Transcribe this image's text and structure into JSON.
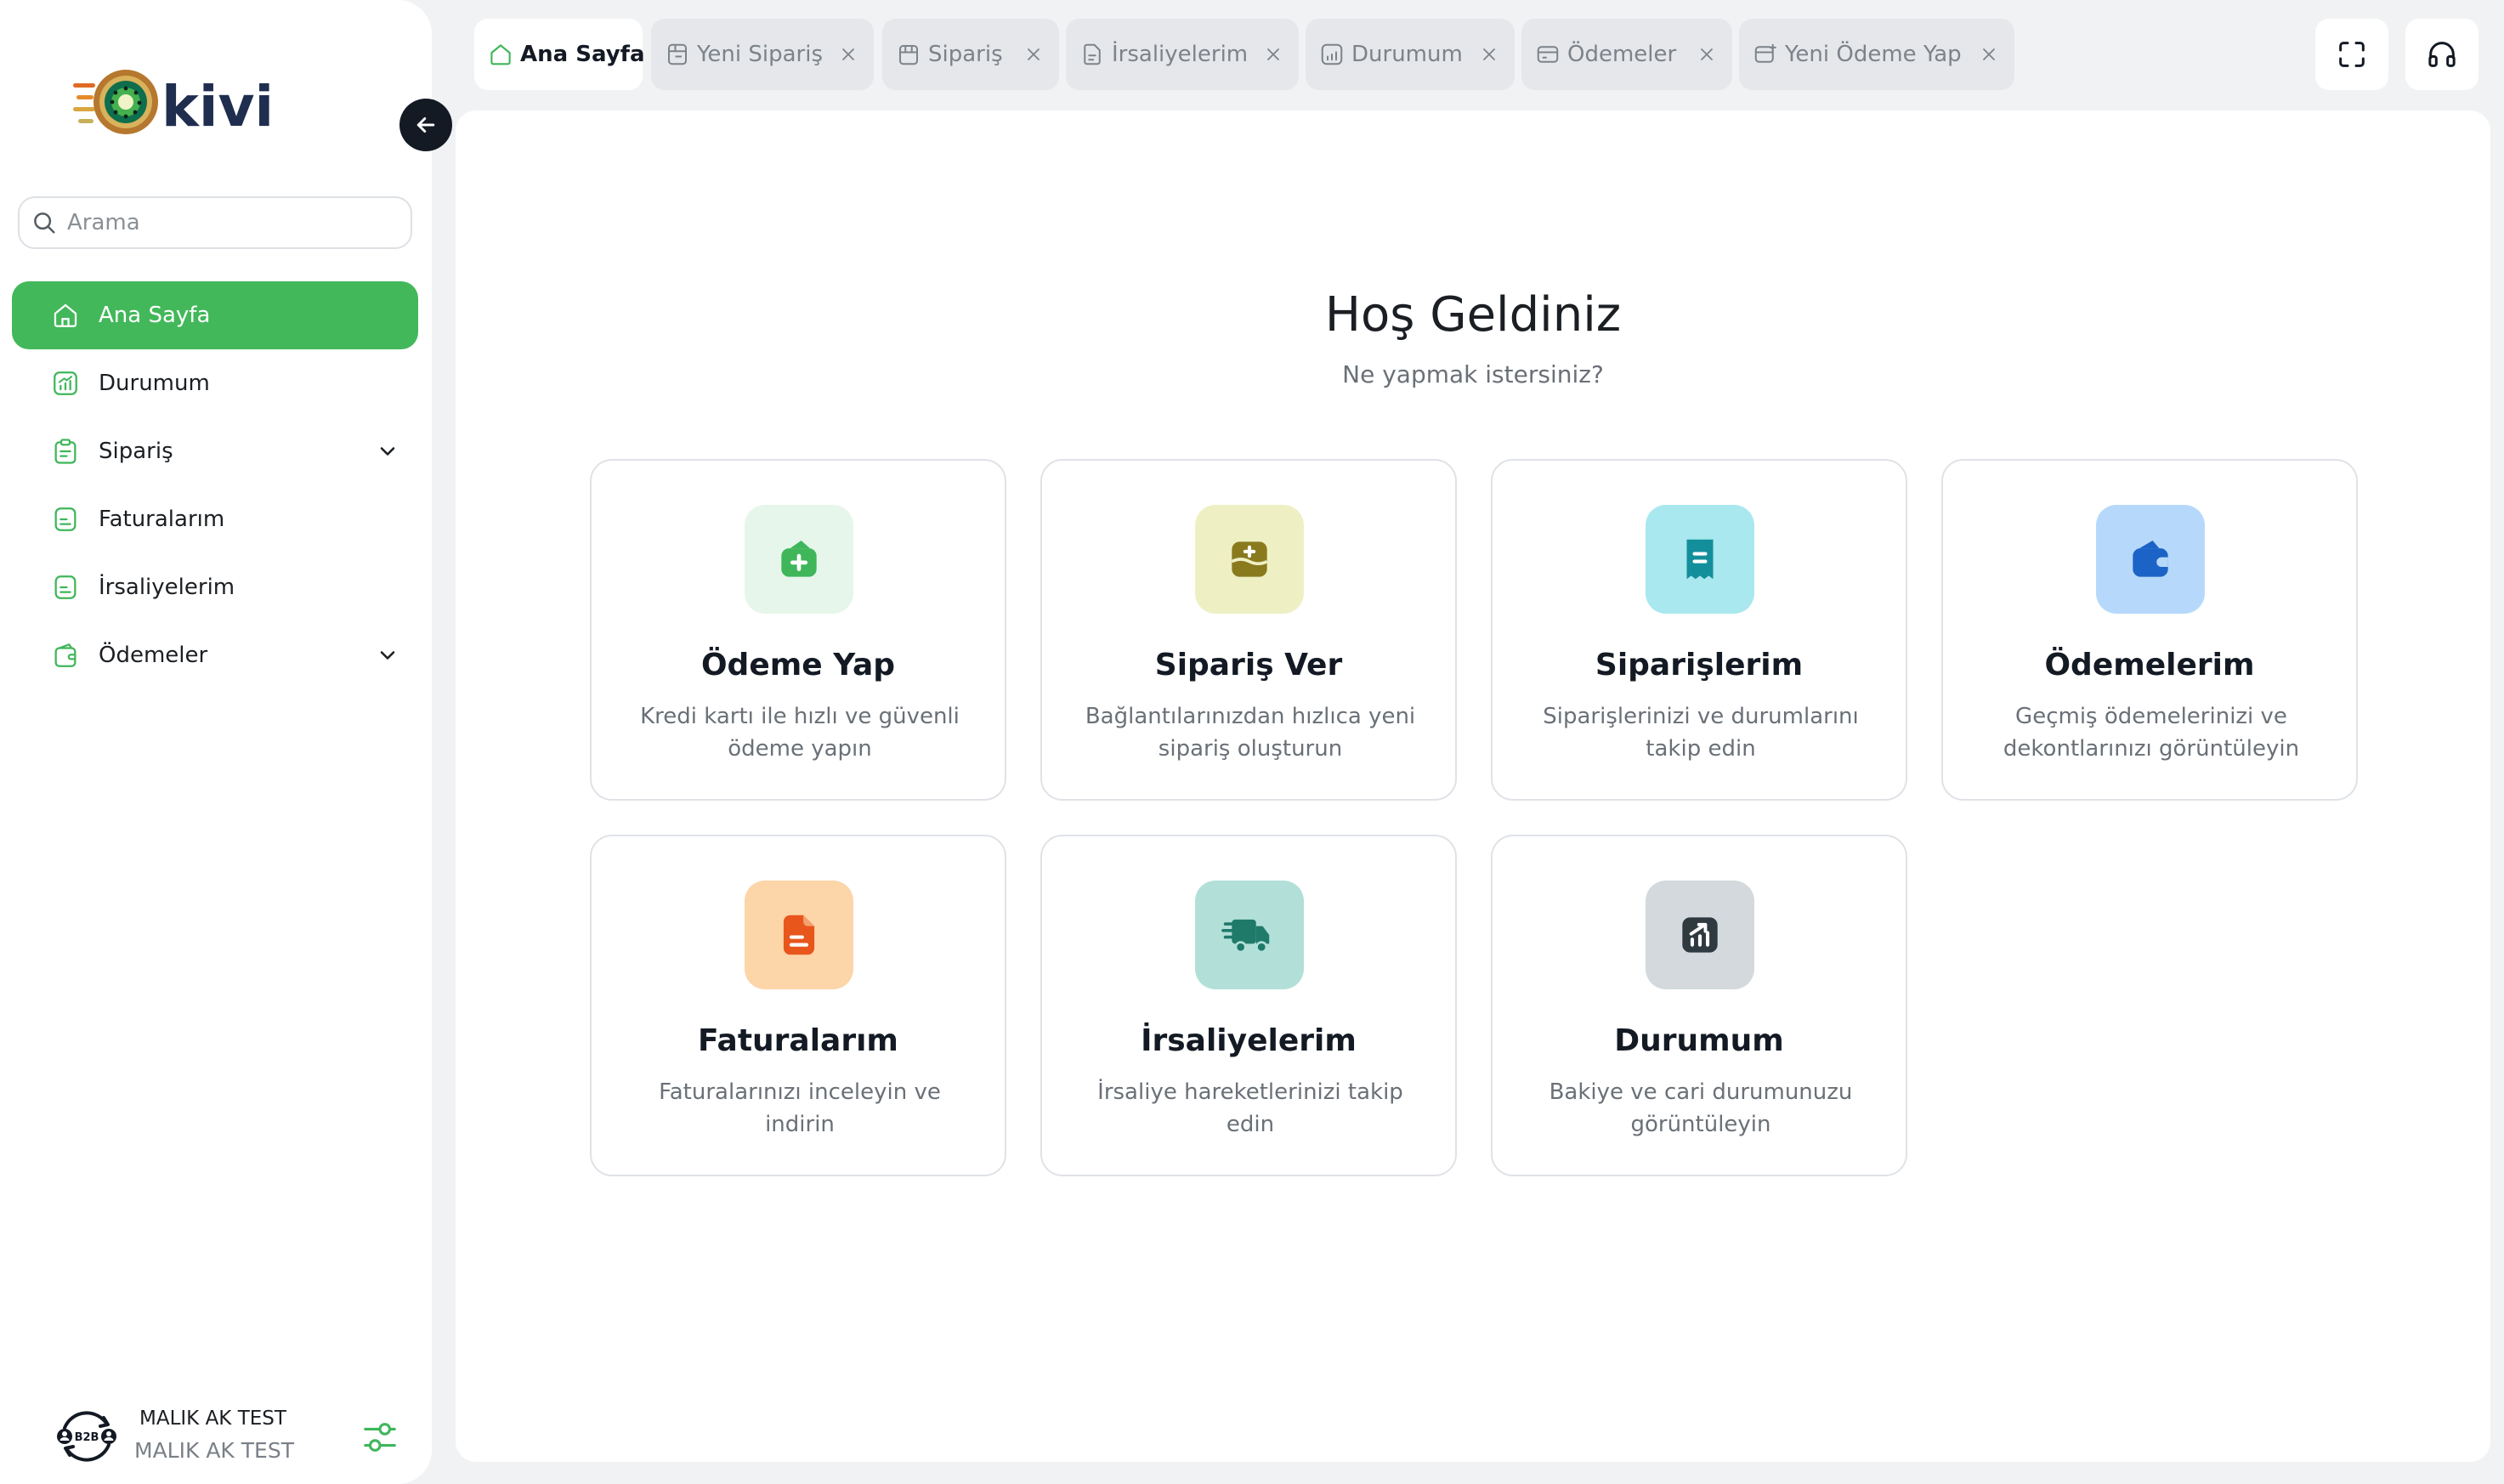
{
  "logo": {
    "text": "kivi"
  },
  "search": {
    "placeholder": "Arama",
    "value": ""
  },
  "sidebar": {
    "items": [
      {
        "label": "Ana Sayfa",
        "icon": "home-icon",
        "active": true
      },
      {
        "label": "Durumum",
        "icon": "chart-icon"
      },
      {
        "label": "Sipariş",
        "icon": "clipboard-icon",
        "expandable": true
      },
      {
        "label": "Faturalarım",
        "icon": "document-icon"
      },
      {
        "label": "İrsaliyelerim",
        "icon": "document-icon"
      },
      {
        "label": "Ödemeler",
        "icon": "wallet-icon",
        "expandable": true
      }
    ]
  },
  "user": {
    "name": "MALIK AK TEST",
    "company": "MALIK AK TEST",
    "avatar_text": "B2B"
  },
  "tabs": [
    {
      "label": "Ana Sayfa",
      "icon": "home-icon",
      "active": true,
      "closable": false
    },
    {
      "label": "Yeni Sipariş",
      "icon": "cart-icon",
      "closable": true
    },
    {
      "label": "Sipariş",
      "icon": "shop-icon",
      "closable": true
    },
    {
      "label": "İrsaliyelerim",
      "icon": "document-icon",
      "closable": true
    },
    {
      "label": "Durumum",
      "icon": "chart-icon",
      "closable": true
    },
    {
      "label": "Ödemeler",
      "icon": "card-icon",
      "closable": true
    },
    {
      "label": "Yeni Ödeme Yap",
      "icon": "payment-add-icon",
      "closable": true
    }
  ],
  "toolbar": {
    "fullscreen_icon": "fullscreen-icon",
    "support_icon": "headphones-icon"
  },
  "main": {
    "title": "Hoş Geldiniz",
    "subtitle": "Ne yapmak istersiniz?",
    "cards": [
      {
        "title": "Ödeme Yap",
        "desc": "Kredi kartı ile hızlı ve güvenli ödeme yapın",
        "icon": "wallet-add-icon",
        "bg": "#e6f6ea",
        "fg": "#3fb65a"
      },
      {
        "title": "Sipariş Ver",
        "desc": "Bağlantılarınızdan hızlıca yeni sipariş oluşturun",
        "icon": "box-add-icon",
        "bg": "#eef0c4",
        "fg": "#8a7a1e"
      },
      {
        "title": "Siparişlerim",
        "desc": "Siparişlerinizi ve durumlarını takip edin",
        "icon": "receipt-icon",
        "bg": "#a8e8ee",
        "fg": "#138f9c"
      },
      {
        "title": "Ödemelerim",
        "desc": "Geçmiş ödemelerinizi ve dekontlarınızı görüntüleyin",
        "icon": "wallet-icon",
        "bg": "#b6d9fb",
        "fg": "#1b63c6"
      },
      {
        "title": "Faturalarım",
        "desc": "Faturalarınızı inceleyin ve indirin",
        "icon": "invoice-icon",
        "bg": "#fcd5a8",
        "fg": "#e8561c"
      },
      {
        "title": "İrsaliyelerim",
        "desc": "İrsaliye hareketlerinizi takip edin",
        "icon": "truck-icon",
        "bg": "#b2e0d8",
        "fg": "#1f7a6a"
      },
      {
        "title": "Durumum",
        "desc": "Bakiye ve cari durumunuzu görüntüleyin",
        "icon": "chart-icon",
        "bg": "#d3d9dd",
        "fg": "#2f3a40"
      }
    ]
  }
}
